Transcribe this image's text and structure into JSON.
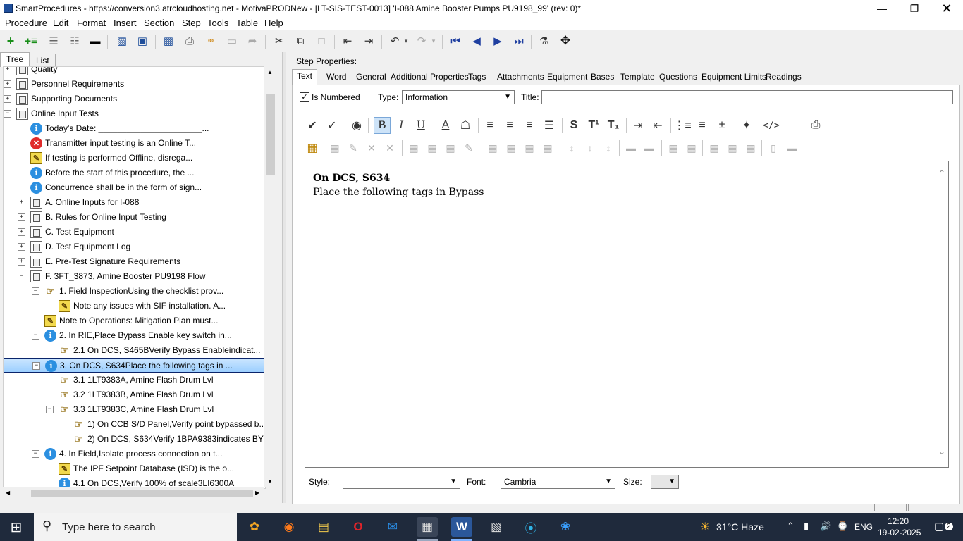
{
  "window": {
    "title": "SmartProcedures - https://conversion3.atrcloudhosting.net - MotivaPRODNew - [LT-SIS-TEST-0013] 'I-088 Amine Booster Pumps PU9198_99' (rev: 0)*"
  },
  "menu": [
    "Procedure",
    "Edit",
    "Format",
    "Insert",
    "Section",
    "Step",
    "Tools",
    "Table",
    "Help"
  ],
  "left_tabs": [
    "Tree",
    "List"
  ],
  "tree": [
    {
      "label": "Quality",
      "icon": "section",
      "indent": 0,
      "expander": "+"
    },
    {
      "label": "Personnel Requirements",
      "icon": "section",
      "indent": 0,
      "expander": "+"
    },
    {
      "label": "Supporting Documents",
      "icon": "section",
      "indent": 0,
      "expander": "+"
    },
    {
      "label": "Online Input Tests",
      "icon": "section",
      "indent": 0,
      "expander": "−"
    },
    {
      "label": "Today's Date: ______________________...",
      "icon": "info",
      "indent": 1,
      "expander": ""
    },
    {
      "label": "Transmitter input testing is an Online T...",
      "icon": "error",
      "indent": 1,
      "expander": ""
    },
    {
      "label": "If testing is performed Offline, disrega...",
      "icon": "note",
      "indent": 1,
      "expander": ""
    },
    {
      "label": "Before the start of this procedure, the ...",
      "icon": "info",
      "indent": 1,
      "expander": ""
    },
    {
      "label": "Concurrence shall be in the form of sign...",
      "icon": "info",
      "indent": 1,
      "expander": ""
    },
    {
      "label": "A. Online Inputs for I-088",
      "icon": "section",
      "indent": 1,
      "expander": "+"
    },
    {
      "label": "B. Rules for Online Input Testing",
      "icon": "section",
      "indent": 1,
      "expander": "+"
    },
    {
      "label": "C. Test Equipment",
      "icon": "section",
      "indent": 1,
      "expander": "+"
    },
    {
      "label": "D. Test Equipment Log",
      "icon": "section",
      "indent": 1,
      "expander": "+"
    },
    {
      "label": "E. Pre-Test Signature Requirements",
      "icon": "section",
      "indent": 1,
      "expander": "+"
    },
    {
      "label": "F. 3FT_3873, Amine Booster PU9198 Flow",
      "icon": "section",
      "indent": 1,
      "expander": "−"
    },
    {
      "label": "1. Field InspectionUsing the checklist prov...",
      "icon": "hand",
      "indent": 2,
      "expander": "−"
    },
    {
      "label": "Note any issues with SIF installation. A...",
      "icon": "note",
      "indent": 3,
      "expander": ""
    },
    {
      "label": "Note to Operations: Mitigation Plan must...",
      "icon": "note",
      "indent": 2,
      "expander": ""
    },
    {
      "label": "2. In RIE,Place Bypass Enable key switch in...",
      "icon": "info",
      "indent": 2,
      "expander": "−"
    },
    {
      "label": "2.1 On DCS, S465BVerify Bypass Enableindicat...",
      "icon": "hand",
      "indent": 3,
      "expander": ""
    },
    {
      "label": "3. On DCS, S634Place the following tags in ...",
      "icon": "info",
      "indent": 2,
      "expander": "−",
      "selected": true
    },
    {
      "label": "3.1 1LT9383A, Amine Flash Drum Lvl",
      "icon": "hand",
      "indent": 3,
      "expander": ""
    },
    {
      "label": "3.2 1LT9383B, Amine Flash Drum Lvl",
      "icon": "hand",
      "indent": 3,
      "expander": ""
    },
    {
      "label": "3.3 1LT9383C, Amine Flash Drum Lvl",
      "icon": "hand",
      "indent": 3,
      "expander": "−"
    },
    {
      "label": "1) On CCB S/D Panel,Verify point bypassed b...",
      "icon": "hand",
      "indent": 4,
      "expander": ""
    },
    {
      "label": "2) On DCS, S634Verify 1BPA9383indicates BYP...",
      "icon": "hand",
      "indent": 4,
      "expander": ""
    },
    {
      "label": "4. In Field,Isolate process connection on t...",
      "icon": "info",
      "indent": 2,
      "expander": "−"
    },
    {
      "label": "The IPF Setpoint Database (ISD) is the o...",
      "icon": "note",
      "indent": 3,
      "expander": ""
    },
    {
      "label": "4.1 On DCS,Verify 100% of scale3LI6300A",
      "icon": "info",
      "indent": 3,
      "expander": ""
    }
  ],
  "step_props": {
    "heading": "Step Properties:",
    "tabs": [
      "Text",
      "Word",
      "General",
      "Additional Properties",
      "Tags",
      "Attachments",
      "Equipment",
      "Bases",
      "Template",
      "Questions",
      "Equipment Limits",
      "Readings"
    ],
    "is_numbered_label": "Is Numbered",
    "is_numbered_checked": "✓",
    "type_label": "Type:",
    "type_value": "Information",
    "title_label": "Title:",
    "title_value": "",
    "editor_line1": "On DCS, S634",
    "editor_line2": "Place the following tags in Bypass",
    "style_label": "Style:",
    "style_value": "",
    "font_label": "Font:",
    "font_value": "Cambria",
    "size_label": "Size:",
    "size_value": ""
  },
  "taskbar": {
    "search_placeholder": "Type here to search",
    "weather": "31°C  Haze",
    "lang": "ENG",
    "time": "12:20",
    "date": "19-02-2025",
    "notif_count": "2"
  },
  "colors": {
    "selection": "#9ccfff",
    "taskbar": "#1f2a3c",
    "info_icon": "#2b8fe0",
    "error_icon": "#e02b2b"
  }
}
